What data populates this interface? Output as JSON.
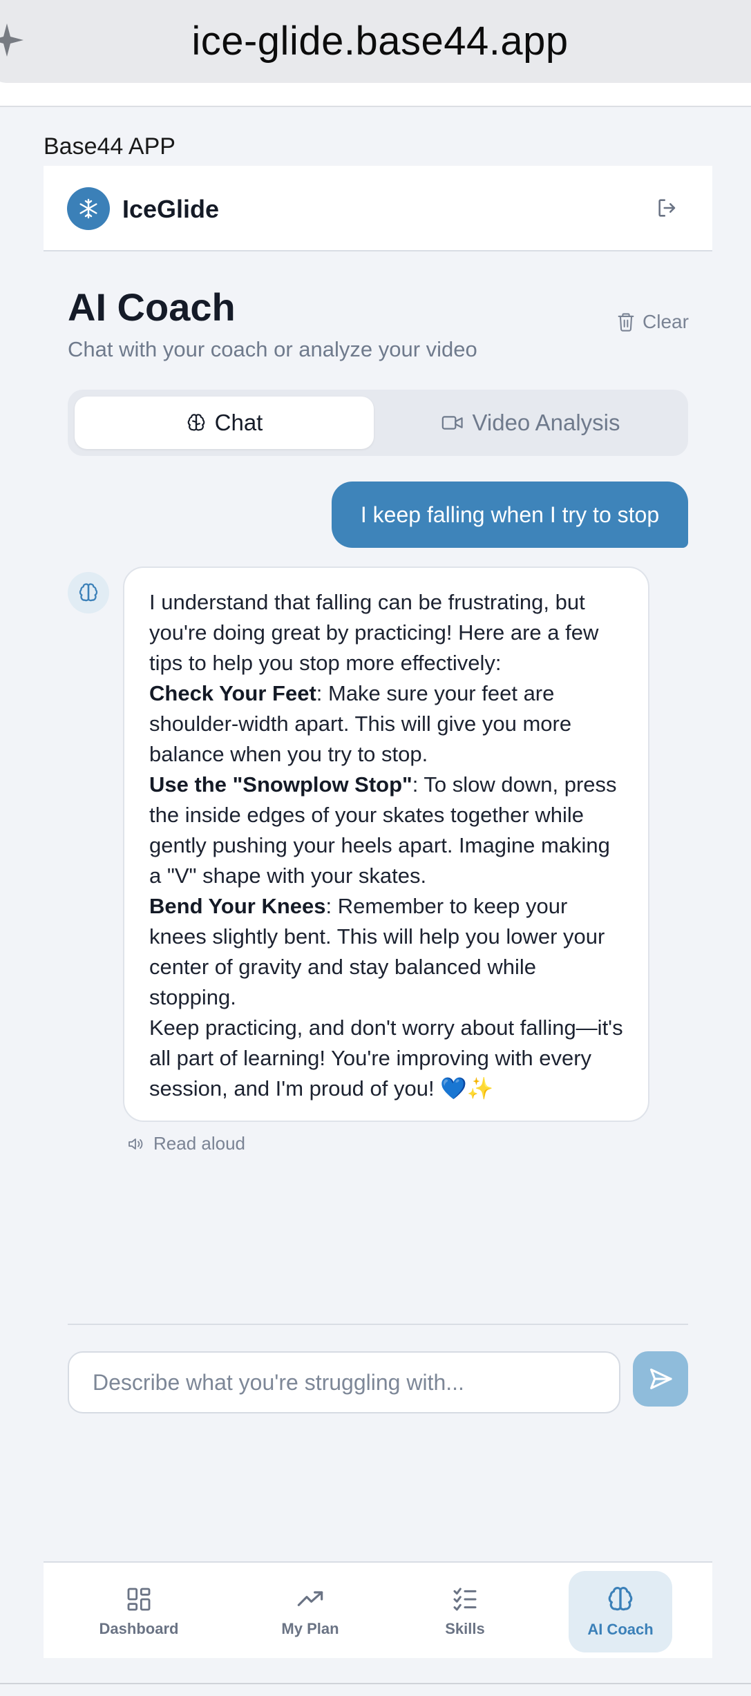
{
  "browser": {
    "url": "ice-glide.base44.app"
  },
  "app_label": "Base44 APP",
  "header": {
    "brand": "IceGlide"
  },
  "page": {
    "title": "AI Coach",
    "subtitle": "Chat with your coach or analyze your video",
    "clear_label": "Clear"
  },
  "tabs": [
    {
      "label": "Chat",
      "active": true
    },
    {
      "label": "Video Analysis",
      "active": false
    }
  ],
  "messages": {
    "user": "I keep falling when I try to stop",
    "coach": {
      "intro": "I understand that falling can be frustrating, but you're doing great by practicing! Here are a few tips to help you stop more effectively:",
      "tips": [
        {
          "title": "Check Your Feet",
          "text": ": Make sure your feet are shoulder-width apart. This will give you more balance when you try to stop."
        },
        {
          "title": "Use the \"Snowplow Stop\"",
          "text": ": To slow down, press the inside edges of your skates together while gently pushing your heels apart. Imagine making a \"V\" shape with your skates."
        },
        {
          "title": "Bend Your Knees",
          "text": ": Remember to keep your knees slightly bent. This will help you lower your center of gravity and stay balanced while stopping."
        }
      ],
      "outro": "Keep practicing, and don't worry about falling—it's all part of learning! You're improving with every session, and I'm proud of you!",
      "emoji": "💙✨"
    },
    "read_aloud": "Read aloud"
  },
  "composer": {
    "placeholder": "Describe what you're struggling with...",
    "value": ""
  },
  "nav": [
    {
      "label": "Dashboard",
      "icon": "grid-icon",
      "active": false
    },
    {
      "label": "My Plan",
      "icon": "trend-icon",
      "active": false
    },
    {
      "label": "Skills",
      "icon": "checklist-icon",
      "active": false
    },
    {
      "label": "AI Coach",
      "icon": "brain-icon",
      "active": true
    }
  ],
  "colors": {
    "accent": "#3b80b8",
    "user_bubble": "#3e84ba",
    "send_button": "#8fbcdb",
    "background": "#f2f4f8"
  }
}
